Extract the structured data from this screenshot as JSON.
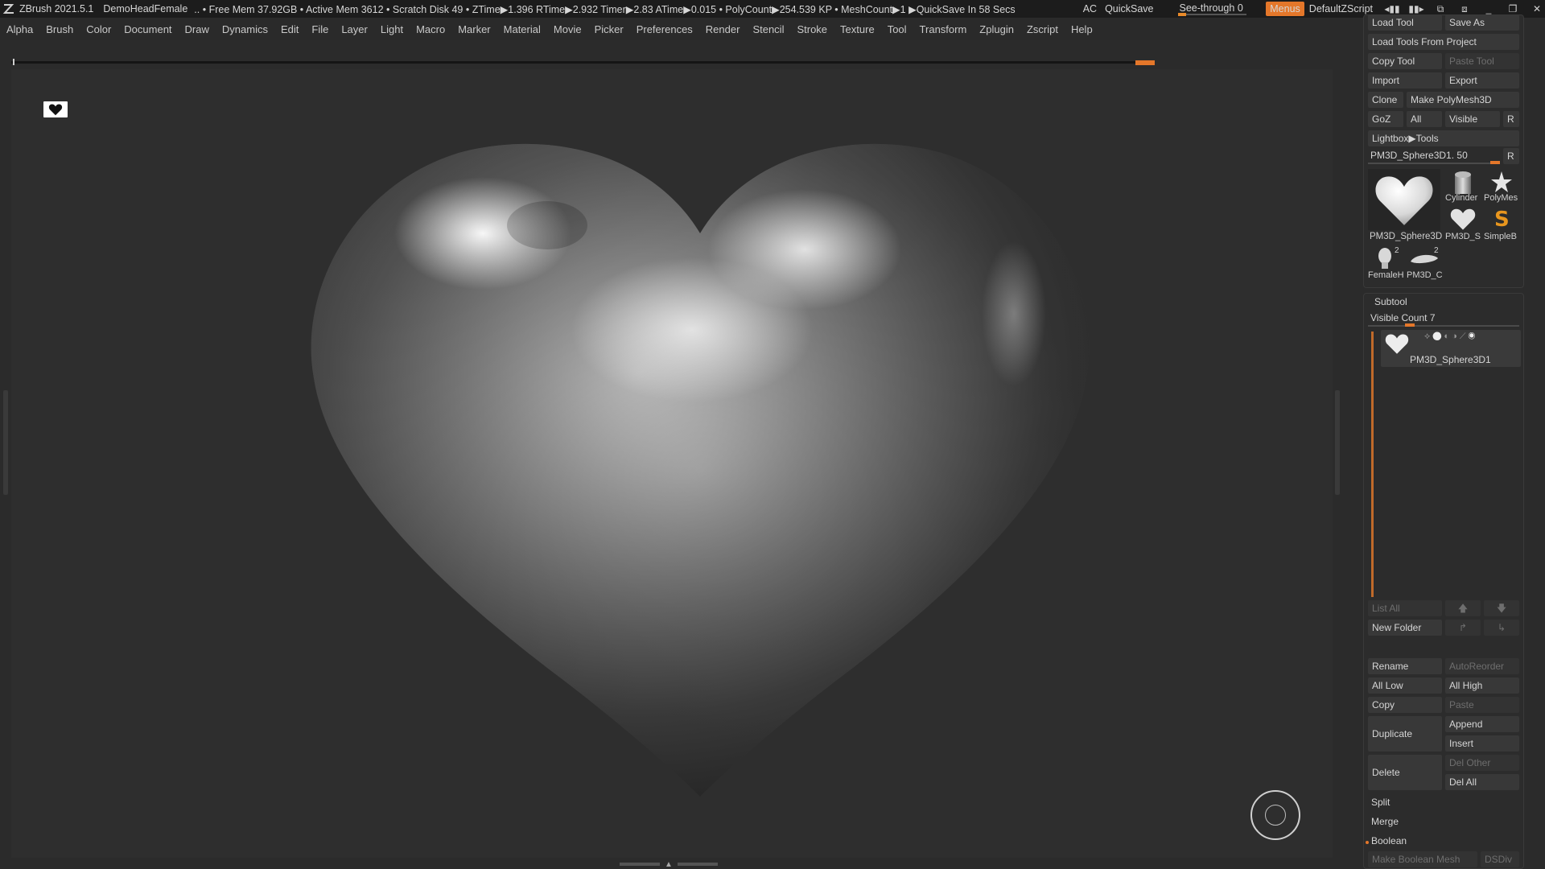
{
  "titlebar": {
    "app": "ZBrush 2021.5.1",
    "document": "DemoHeadFemale",
    "stats": "..  • Free Mem 37.92GB • Active Mem 3612 • Scratch Disk 49 •  ZTime▶1.396 RTime▶2.932 Timer▶2.83 ATime▶0.015 • PolyCount▶254.539 KP  • MeshCount▶1  ▶QuickSave In 58 Secs",
    "ac": "AC",
    "quicksave": "QuickSave",
    "seethrough_label": "See-through",
    "seethrough_value": "0",
    "menus": "Menus",
    "script": "DefaultZScript"
  },
  "menubar": [
    "Alpha",
    "Brush",
    "Color",
    "Document",
    "Draw",
    "Dynamics",
    "Edit",
    "File",
    "Layer",
    "Light",
    "Macro",
    "Marker",
    "Material",
    "Movie",
    "Picker",
    "Preferences",
    "Render",
    "Stencil",
    "Stroke",
    "Texture",
    "Tool",
    "Transform",
    "Zplugin",
    "Zscript",
    "Help"
  ],
  "tool_panel": {
    "load_tool": "Load Tool",
    "save_as": "Save As",
    "load_tools_from_project": "Load Tools From Project",
    "copy_tool": "Copy Tool",
    "paste_tool": "Paste Tool",
    "import": "Import",
    "export": "Export",
    "clone": "Clone",
    "make_polymesh": "Make PolyMesh3D",
    "goz": "GoZ",
    "all": "All",
    "visible": "Visible",
    "r": "R",
    "lightbox_tools": "Lightbox▶Tools",
    "current_tool": "PM3D_Sphere3D1. 50",
    "current_tool_r": "R",
    "thumbs": {
      "main": "PM3D_Sphere3D",
      "cylinder": "Cylinder",
      "polymesh": "PolyMes",
      "pm3d_s": "PM3D_S",
      "simpleb": "SimpleB",
      "female": "FemaleH",
      "female_count": "2",
      "pm3d_c": "PM3D_C",
      "pm3d_c_count": "2"
    }
  },
  "subtool": {
    "title": "Subtool",
    "visible_count": "Visible Count 7",
    "item_name": "PM3D_Sphere3D1",
    "list_all": "List All",
    "new_folder": "New Folder",
    "rename": "Rename",
    "autoreorder": "AutoReorder",
    "all_low": "All Low",
    "all_high": "All High",
    "copy": "Copy",
    "paste": "Paste",
    "duplicate": "Duplicate",
    "append": "Append",
    "insert": "Insert",
    "delete": "Delete",
    "del_other": "Del Other",
    "del_all": "Del All",
    "split": "Split",
    "merge": "Merge",
    "boolean": "Boolean",
    "make_boolean_mesh": "Make Boolean Mesh",
    "dsdiv": "DSDiv"
  },
  "colors": {
    "accent": "#e4772a"
  }
}
